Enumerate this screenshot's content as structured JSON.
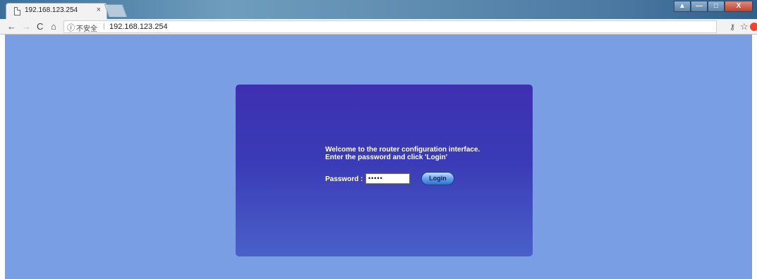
{
  "browser": {
    "tab_title": "192.168.123.254",
    "tab_close": "×",
    "security_label": "不安全",
    "separator": "|",
    "url": "192.168.123.254",
    "nav": {
      "back": "←",
      "forward": "→",
      "reload": "C",
      "home": "⌂",
      "info": "ⓘ",
      "key": "⚷",
      "star": "☆"
    },
    "window_buttons": [
      "▲",
      "—",
      "□",
      "X"
    ]
  },
  "login": {
    "welcome_line1": "Welcome to the router configuration interface.",
    "welcome_line2": "Enter the password and click 'Login'",
    "password_label": "Password :",
    "password_value": "•••••",
    "login_button": "Login"
  },
  "colors": {
    "page_background": "#7a9ee4",
    "card_top": "#3e30b0",
    "card_bottom": "#4a60c9"
  }
}
